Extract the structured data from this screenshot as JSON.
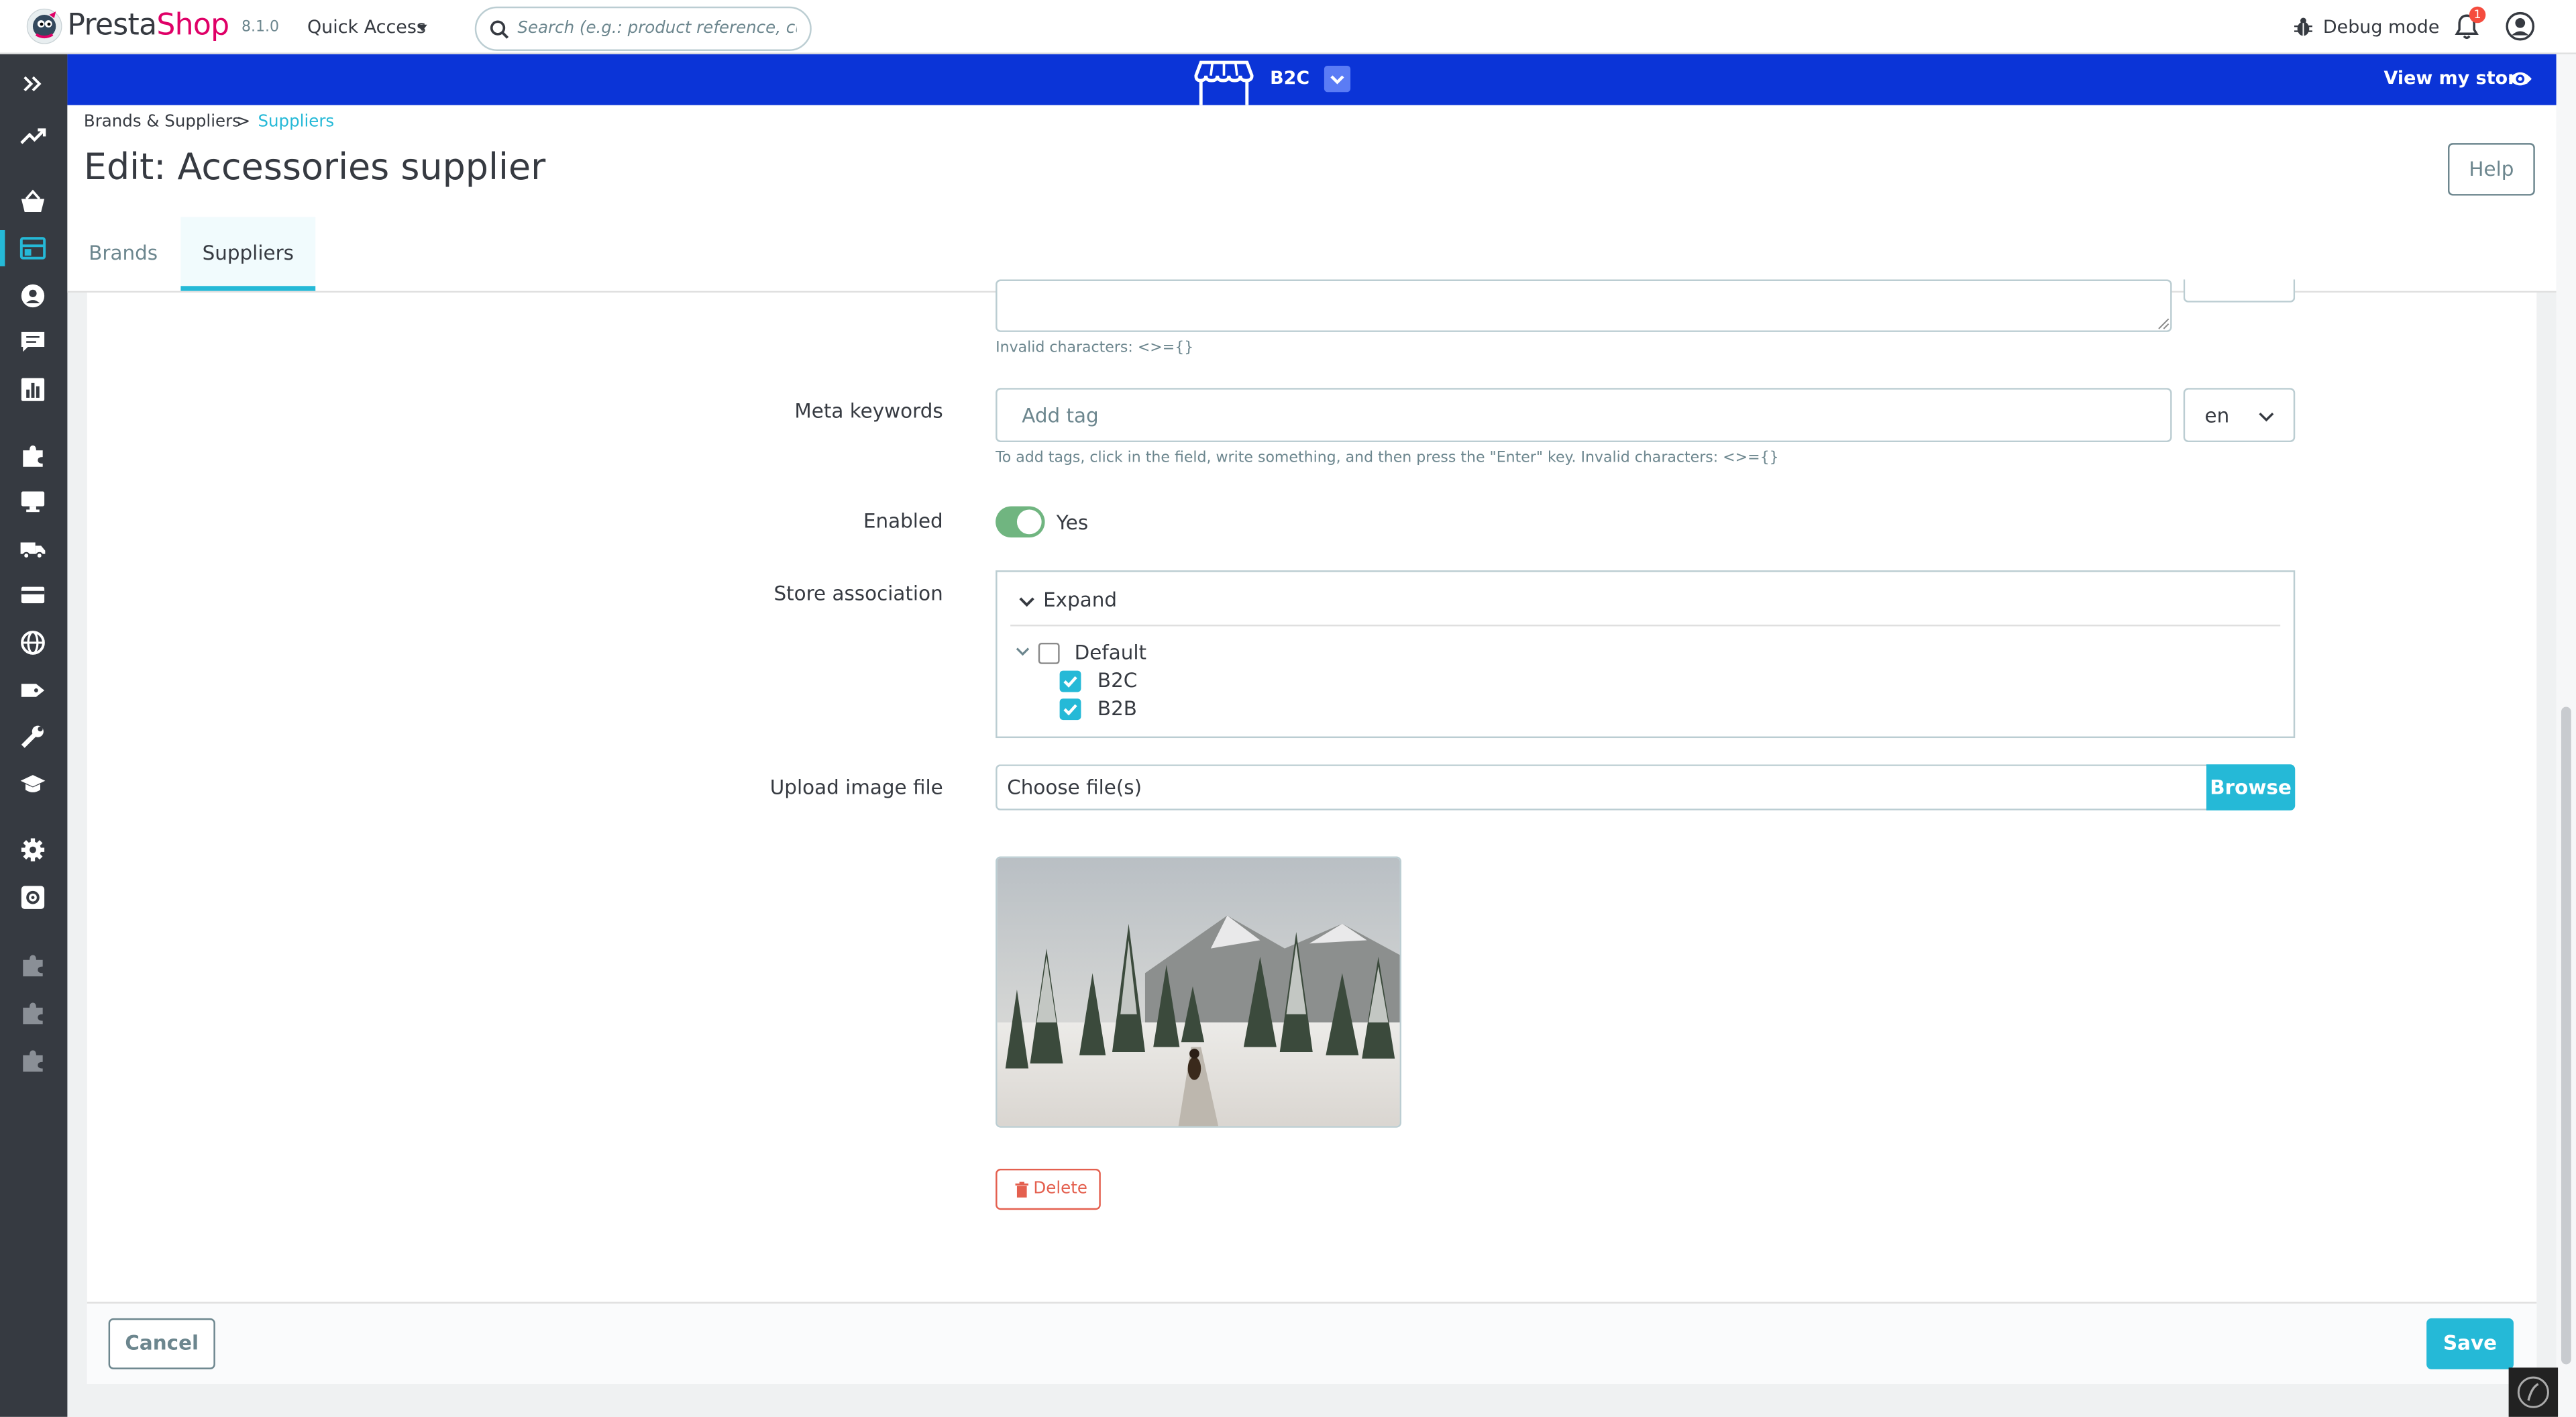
{
  "header": {
    "brand_name": "PrestaShop",
    "version": "8.1.0",
    "quick_access": "Quick Access",
    "search_placeholder": "Search (e.g.: product reference, custon",
    "debug_mode": "Debug mode",
    "notification_count": "1"
  },
  "store_bar": {
    "store_name": "B2C",
    "view_store": "View my store",
    "bar_color": "#0b34d7"
  },
  "sidebar": {
    "icons": [
      "collapse-icon",
      "dashboard-icon",
      "orders-icon",
      "catalog-icon",
      "customers-icon",
      "messages-icon",
      "stats-icon",
      "modules-icon",
      "design-icon",
      "shipping-icon",
      "payment-icon",
      "international-icon",
      "marketing-icon",
      "advanced-icon",
      "academy-icon",
      "settings-icon",
      "configure-icon",
      "module-icon",
      "module-icon",
      "module-icon"
    ],
    "active": "catalog-icon"
  },
  "breadcrumb": {
    "parent": "Brands & Suppliers",
    "separator": ">",
    "current": "Suppliers"
  },
  "page": {
    "title": "Edit: Accessories supplier",
    "help": "Help",
    "tabs": [
      {
        "label": "Brands",
        "active": false
      },
      {
        "label": "Suppliers",
        "active": true
      }
    ]
  },
  "form": {
    "meta_description_hint": "Invalid characters: <>={}",
    "meta_keywords_label": "Meta keywords",
    "meta_keywords_placeholder": "Add tag",
    "language": "en",
    "meta_keywords_hint": "To add tags, click in the field, write something, and then press the \"Enter\" key. Invalid characters: <>={}",
    "enabled_label": "Enabled",
    "enabled_value": "Yes",
    "store_association_label": "Store association",
    "expand": "Expand",
    "stores": [
      {
        "name": "Default",
        "checked": false
      },
      {
        "name": "B2C",
        "checked": true
      },
      {
        "name": "B2B",
        "checked": true
      }
    ],
    "upload_label": "Upload image file",
    "file_placeholder": "Choose file(s)",
    "browse": "Browse",
    "delete": "Delete"
  },
  "footer": {
    "cancel": "Cancel",
    "save": "Save"
  },
  "colors": {
    "accent": "#25b9d7",
    "toggle_on": "#70b580",
    "danger": "#e4604f",
    "sidebar": "#363a41"
  }
}
